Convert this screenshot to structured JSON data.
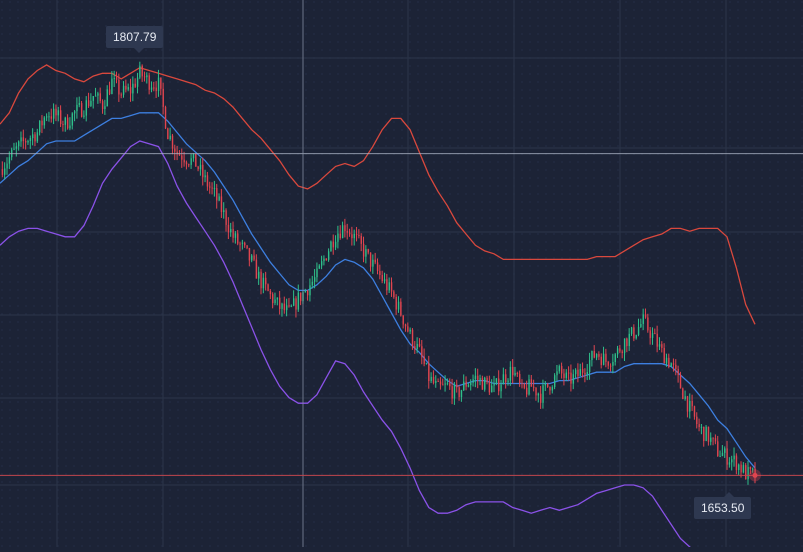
{
  "chart_data": {
    "type": "candlestick",
    "indicator": "bollinger-bands",
    "ylim": [
      1632,
      1826
    ],
    "grid": true,
    "colors": {
      "background": "#1c2336",
      "grid": "#2b3449",
      "candle_up": "#2fbf8a",
      "candle_down": "#e0454f",
      "upper_band": "#d9483d",
      "middle_band": "#3d7fe0",
      "lower_band": "#8a52e8",
      "crosshair_h": "#aab2c2",
      "crosshair_v": "#8891a5",
      "last_price_line": "#c0464e",
      "label_bg": "#2e3850",
      "label_text": "#e8ecf4"
    },
    "annotations": {
      "high_label": "1807.79",
      "high_value": 1807.79,
      "low_label": "1653.50",
      "low_value": 1653.5
    },
    "crosshair": {
      "price": 1771.5
    },
    "last_price": 1657.4,
    "upper_band": [
      1782,
      1786,
      1793,
      1798,
      1801,
      1803,
      1801,
      1800,
      1798,
      1797,
      1799,
      1800,
      1800,
      1798,
      1800,
      1802,
      1801,
      1800,
      1799,
      1798,
      1797,
      1796,
      1794,
      1793,
      1791,
      1788,
      1784,
      1780,
      1777,
      1773,
      1769,
      1764,
      1760,
      1759,
      1761,
      1764,
      1767,
      1768,
      1767,
      1769,
      1774,
      1780,
      1784,
      1784,
      1780,
      1772,
      1764,
      1758,
      1753,
      1747,
      1743,
      1739,
      1737,
      1736,
      1734,
      1734,
      1734,
      1734,
      1734,
      1734,
      1734,
      1734,
      1734,
      1734,
      1735,
      1735,
      1735,
      1737,
      1739,
      1741,
      1742,
      1743,
      1745,
      1745,
      1744,
      1745,
      1745,
      1745,
      1742,
      1731,
      1718,
      1711
    ],
    "middle_band": [
      1761,
      1764,
      1767,
      1769,
      1772,
      1775,
      1776,
      1776,
      1776,
      1778,
      1780,
      1782,
      1784,
      1784,
      1785,
      1786,
      1786,
      1786,
      1783,
      1779,
      1775,
      1772,
      1769,
      1765,
      1760,
      1755,
      1749,
      1743,
      1738,
      1733,
      1729,
      1725,
      1723,
      1723,
      1725,
      1728,
      1732,
      1734,
      1733,
      1731,
      1727,
      1721,
      1715,
      1709,
      1704,
      1701,
      1697,
      1694,
      1691,
      1689,
      1690,
      1691,
      1691,
      1690,
      1690,
      1690,
      1690,
      1690,
      1690,
      1690,
      1691,
      1691,
      1692,
      1693,
      1694,
      1694,
      1694,
      1696,
      1697,
      1697,
      1697,
      1697,
      1696,
      1693,
      1690,
      1686,
      1682,
      1677,
      1674,
      1669,
      1664,
      1660
    ],
    "lower_band": [
      1739,
      1742,
      1744,
      1745,
      1745,
      1744,
      1743,
      1742,
      1742,
      1746,
      1753,
      1761,
      1766,
      1770,
      1774,
      1776,
      1775,
      1774,
      1768,
      1760,
      1754,
      1749,
      1744,
      1739,
      1733,
      1726,
      1718,
      1710,
      1702,
      1695,
      1689,
      1685,
      1683,
      1683,
      1686,
      1692,
      1698,
      1697,
      1693,
      1687,
      1682,
      1677,
      1673,
      1667,
      1660,
      1652,
      1646,
      1644,
      1644,
      1645,
      1647,
      1648,
      1648,
      1648,
      1648,
      1646,
      1645,
      1644,
      1645,
      1646,
      1645,
      1646,
      1647,
      1649,
      1651,
      1652,
      1653,
      1654,
      1654,
      1653,
      1650,
      1645,
      1640,
      1635,
      1632,
      1629,
      1628,
      1629,
      1630,
      1628,
      1627,
      1626
    ],
    "closes": [
      1766,
      1770,
      1774,
      1777,
      1779,
      1786,
      1785,
      1782,
      1786,
      1788,
      1792,
      1789,
      1797,
      1793,
      1794,
      1800,
      1797,
      1796,
      1779,
      1772,
      1770,
      1768,
      1762,
      1757,
      1750,
      1742,
      1738,
      1733,
      1726,
      1721,
      1717,
      1715,
      1720,
      1724,
      1728,
      1736,
      1743,
      1746,
      1742,
      1737,
      1732,
      1727,
      1722,
      1715,
      1707,
      1701,
      1692,
      1688,
      1689,
      1686,
      1690,
      1692,
      1690,
      1688,
      1692,
      1695,
      1687,
      1689,
      1686,
      1690,
      1694,
      1691,
      1693,
      1697,
      1701,
      1698,
      1700,
      1705,
      1708,
      1712,
      1707,
      1701,
      1697,
      1689,
      1681,
      1674,
      1671,
      1666,
      1664,
      1662,
      1658,
      1657.4
    ]
  }
}
